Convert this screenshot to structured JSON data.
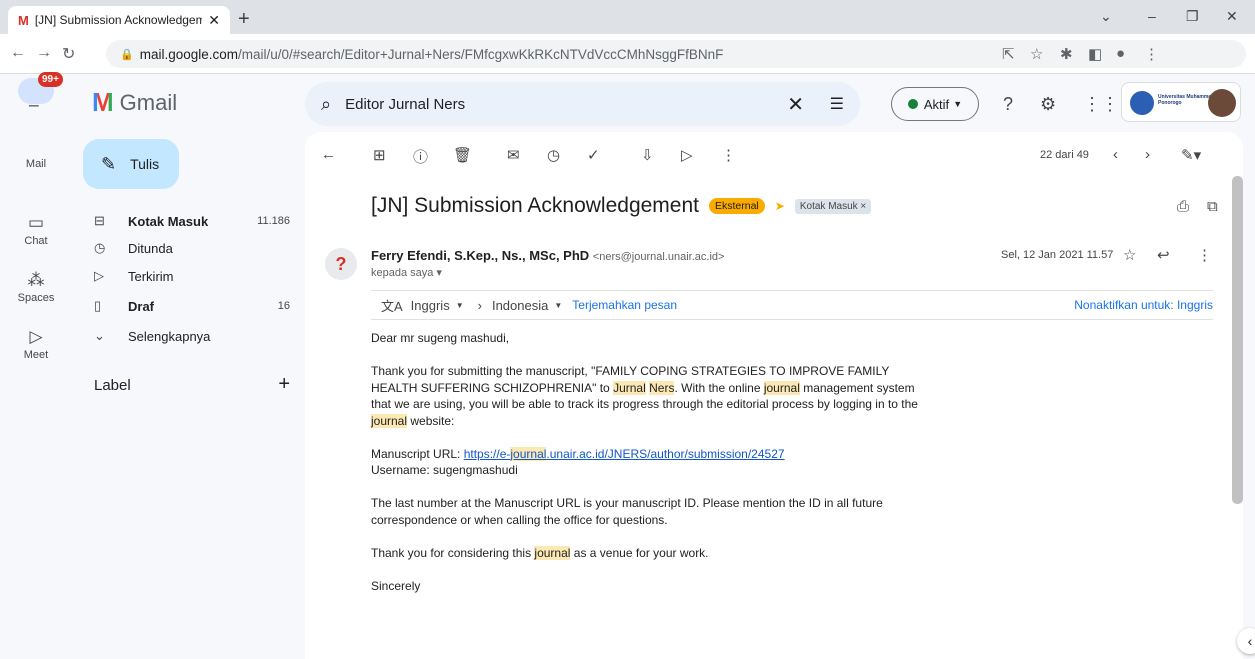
{
  "browser": {
    "tab_title": "[JN] Submission Acknowledgeme",
    "favicon": "M",
    "url_host": "mail.google.com",
    "url_path": "/mail/u/0/#search/Editor+Jurnal+Ners/FMfcgxwKkRKcNTVdVccCMhNsggFfBNnF"
  },
  "gmail": {
    "logo_text": "Gmail",
    "search_value": "Editor Jurnal Ners",
    "status": "Aktif",
    "org_name": "Universitas Muhammadiyah Ponorogo"
  },
  "rail": {
    "badge": "99+",
    "items": [
      {
        "label": "Mail",
        "icon": "mail-icon"
      },
      {
        "label": "Chat",
        "icon": "chat-icon"
      },
      {
        "label": "Spaces",
        "icon": "spaces-icon"
      },
      {
        "label": "Meet",
        "icon": "meet-icon"
      }
    ]
  },
  "sidebar": {
    "compose": "Tulis",
    "items": [
      {
        "label": "Kotak Masuk",
        "count": "11.186",
        "icon": "inbox-icon"
      },
      {
        "label": "Ditunda",
        "count": "",
        "icon": "clock-icon"
      },
      {
        "label": "Terkirim",
        "count": "",
        "icon": "send-icon"
      },
      {
        "label": "Draf",
        "count": "16",
        "icon": "draft-icon"
      },
      {
        "label": "Selengkapnya",
        "count": "",
        "icon": "chevron-down-icon"
      }
    ],
    "label_header": "Label"
  },
  "toolbar": {
    "pager": "22 dari 49"
  },
  "message": {
    "subject": "[JN] Submission Acknowledgement",
    "chip_external": "Eksternal",
    "chip_inbox": "Kotak Masuk ×",
    "sender_name": "Ferry Efendi, S.Kep., Ns., MSc, PhD",
    "sender_email": "<ners@journal.unair.ac.id>",
    "to": "kepada saya ▾",
    "date": "Sel, 12 Jan 2021 11.57",
    "translate": {
      "from": "Inggris",
      "to": "Indonesia",
      "action": "Terjemahkan pesan",
      "disable": "Nonaktifkan untuk: Inggris"
    },
    "body": {
      "greeting": "Dear mr sugeng mashudi,",
      "p1_a": "Thank you for submitting the manuscript, \"FAMILY COPING STRATEGIES TO IMPROVE FAMILY HEALTH SUFFERING SCHIZOPHRENIA\" to ",
      "p1_hl1": "Jurnal",
      "p1_hl2": "Ners",
      "p1_b": ". With the online ",
      "p1_hl3": "journal",
      "p1_c": " management system that we are using, you will be able to track its progress through the editorial process by logging in to the ",
      "p1_hl4": "journal",
      "p1_d": " website:",
      "url_label": "Manuscript URL: ",
      "url_a": "https://e-",
      "url_hl": "journal",
      "url_b": ".unair.ac.id/JNERS/author/submission/24527",
      "username": "Username: sugengmashudi",
      "p3": "The last number at the Manuscript URL is your manuscript ID. Please mention the ID in all future correspondence or when calling the office for questions.",
      "p4_a": "Thank you for considering this ",
      "p4_hl": "journal",
      "p4_b": " as a venue for your work.",
      "closing": "Sincerely"
    }
  }
}
